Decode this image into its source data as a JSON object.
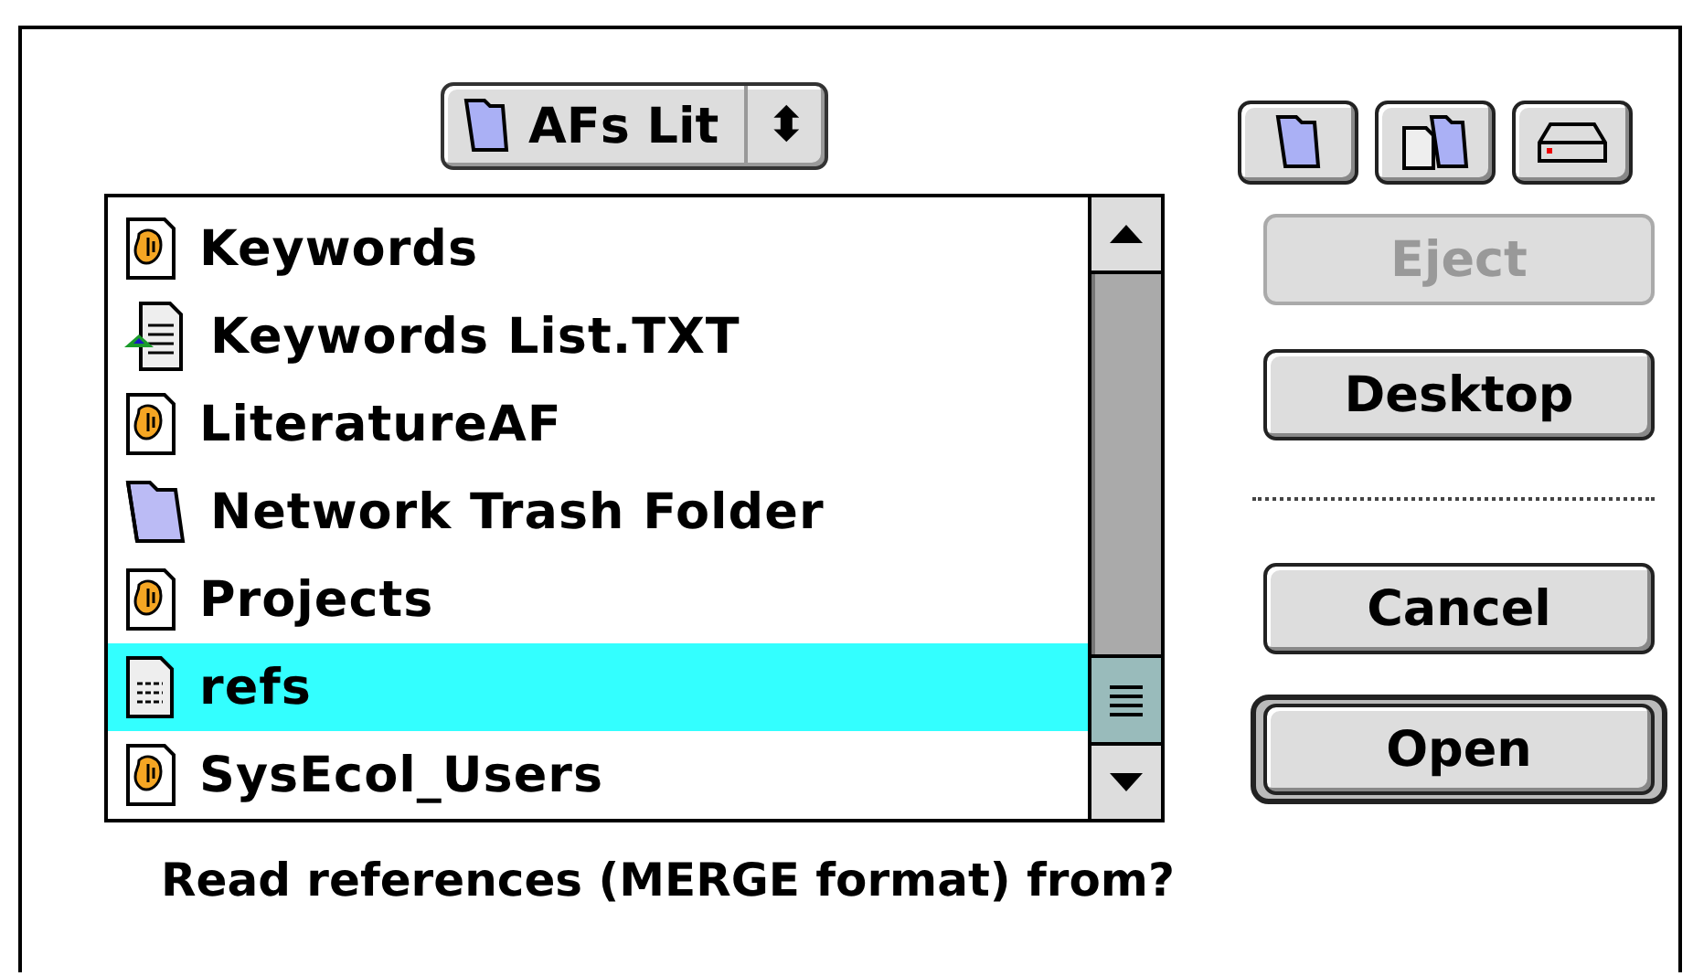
{
  "location_popup": {
    "label": "AFs Lit",
    "arrows": "⬍"
  },
  "files": [
    {
      "name": "Keywords",
      "kind": "app",
      "selected": false
    },
    {
      "name": "Keywords List.TXT",
      "kind": "text",
      "selected": false
    },
    {
      "name": "LiteratureAF",
      "kind": "app",
      "selected": false
    },
    {
      "name": "Network Trash Folder",
      "kind": "folder",
      "selected": false
    },
    {
      "name": "Projects",
      "kind": "app",
      "selected": false
    },
    {
      "name": "refs",
      "kind": "note",
      "selected": true
    },
    {
      "name": "SysEcol_Users",
      "kind": "app",
      "selected": false
    }
  ],
  "tool_buttons": [
    {
      "kind": "folder"
    },
    {
      "kind": "docfolder"
    },
    {
      "kind": "drive"
    }
  ],
  "buttons": [
    {
      "label": "Eject",
      "disabled": true,
      "default": false
    },
    {
      "label": "Desktop",
      "disabled": false,
      "default": false
    },
    {
      "kind": "separator"
    },
    {
      "label": "Cancel",
      "disabled": false,
      "default": false
    },
    {
      "label": "Open",
      "disabled": false,
      "default": true
    }
  ],
  "prompt": "Read references (MERGE format) from?"
}
